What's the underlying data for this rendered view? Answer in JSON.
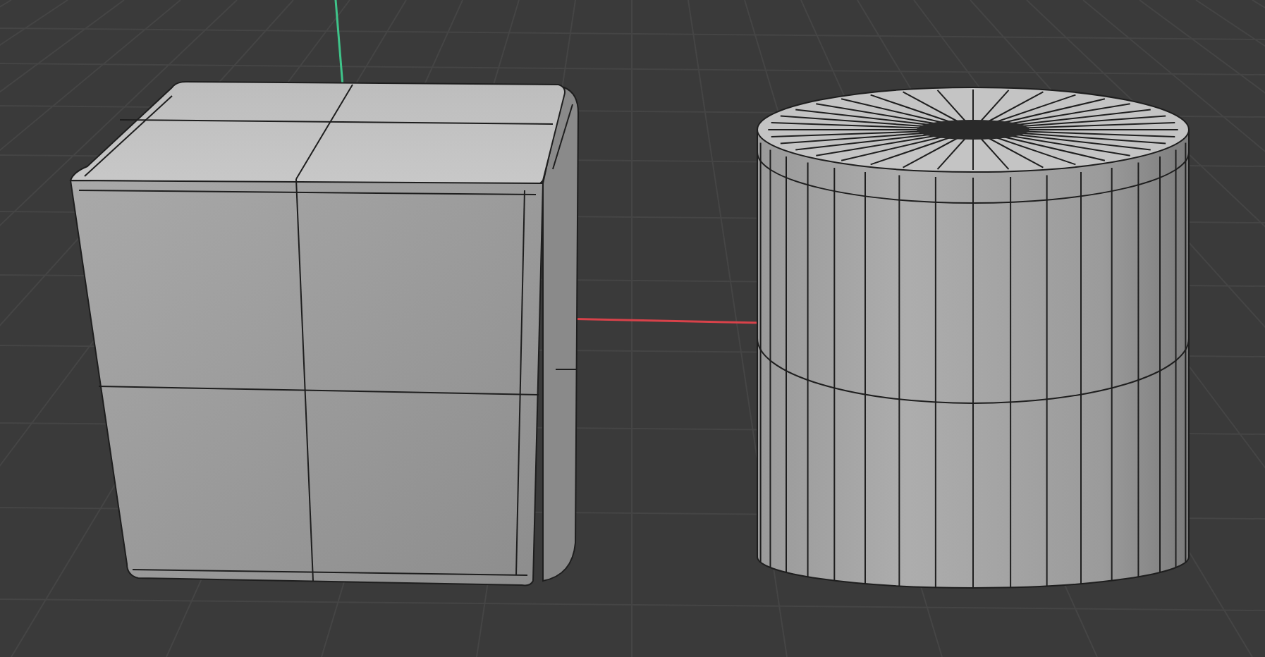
{
  "viewport": {
    "objects": [
      {
        "kind": "cube"
      },
      {
        "kind": "cylinder"
      }
    ]
  }
}
